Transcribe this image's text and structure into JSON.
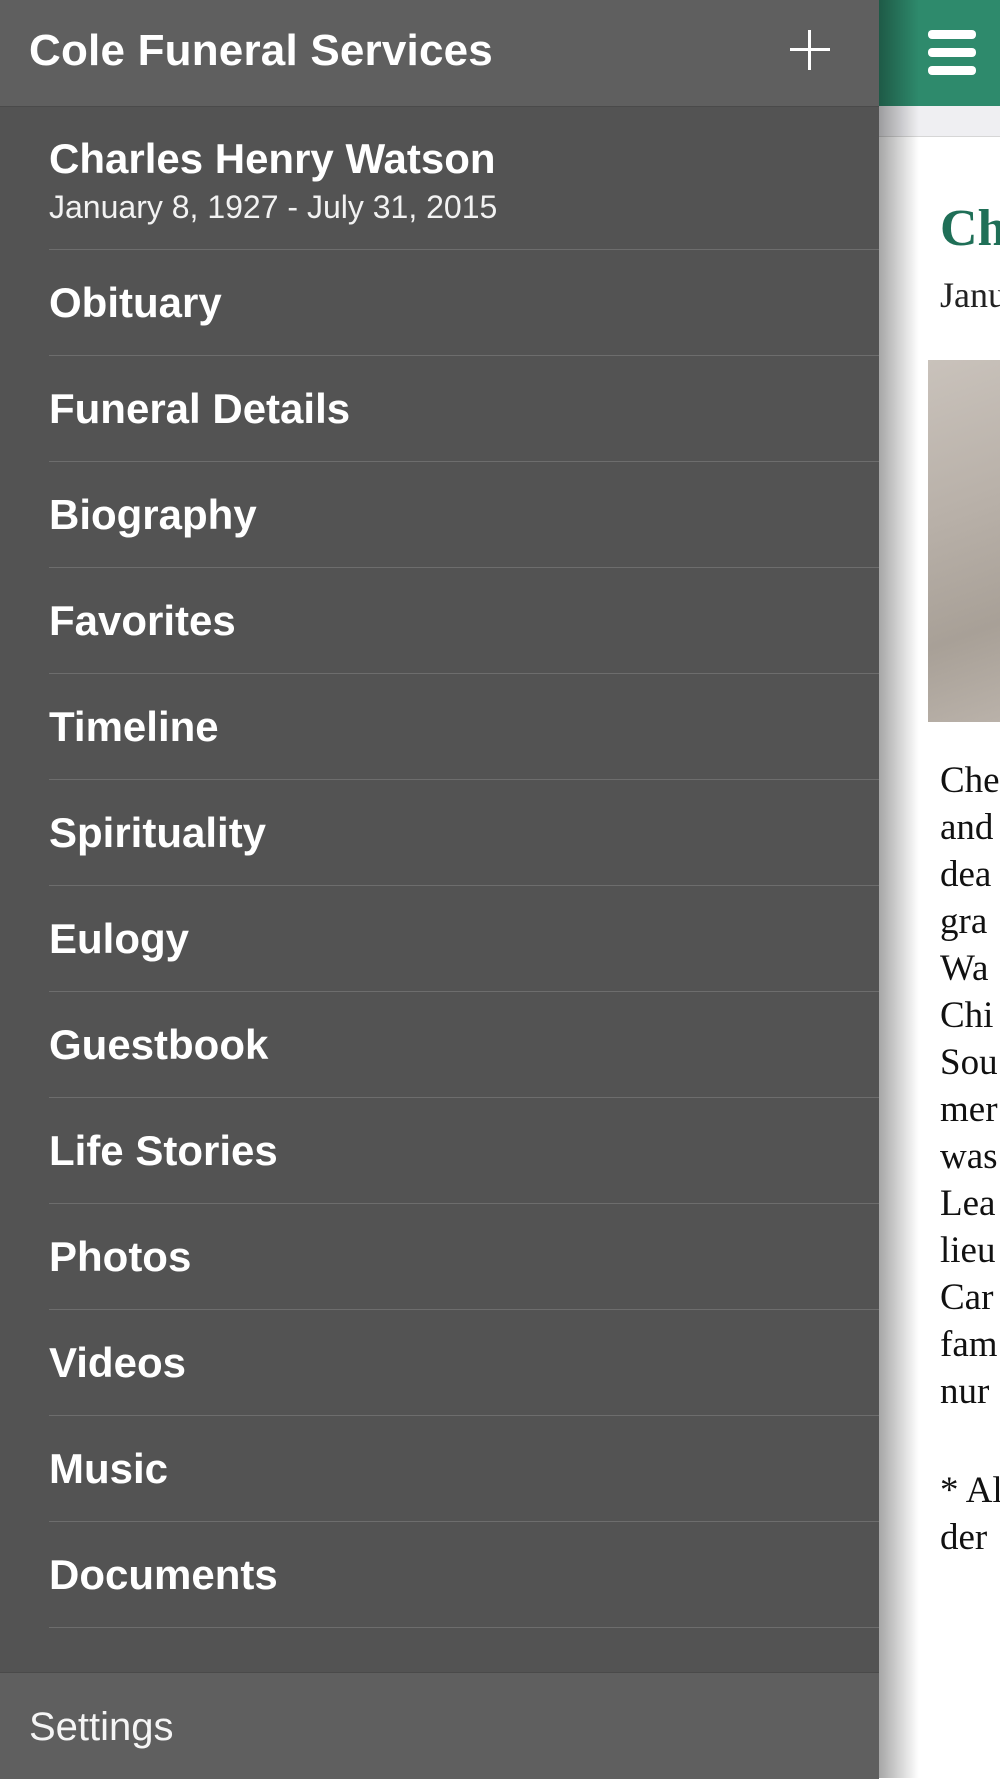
{
  "drawer": {
    "title": "Cole Funeral Services",
    "add_icon": "plus-icon",
    "profile": {
      "name": "Charles Henry Watson",
      "dates": "January 8, 1927 - July 31, 2015"
    },
    "menu": [
      {
        "label": "Obituary"
      },
      {
        "label": "Funeral Details"
      },
      {
        "label": "Biography"
      },
      {
        "label": "Favorites"
      },
      {
        "label": "Timeline"
      },
      {
        "label": "Spirituality"
      },
      {
        "label": "Eulogy"
      },
      {
        "label": "Guestbook"
      },
      {
        "label": "Life Stories"
      },
      {
        "label": "Photos"
      },
      {
        "label": "Videos"
      },
      {
        "label": "Music"
      },
      {
        "label": "Documents"
      }
    ],
    "footer": {
      "settings_label": "Settings"
    }
  },
  "main": {
    "menu_icon": "hamburger-icon",
    "accent_color": "#2e8a6c",
    "heading_fragment": "Ch",
    "dates_fragment": "Janu",
    "body_fragments": [
      "Che",
      "and",
      "dea",
      "gra",
      "Wa",
      "Chi",
      "Sou",
      "mer",
      "was",
      "Lea",
      "lieu",
      "Car",
      "fam",
      "nur"
    ],
    "footnote_fragments": [
      "* Al",
      "der"
    ]
  }
}
